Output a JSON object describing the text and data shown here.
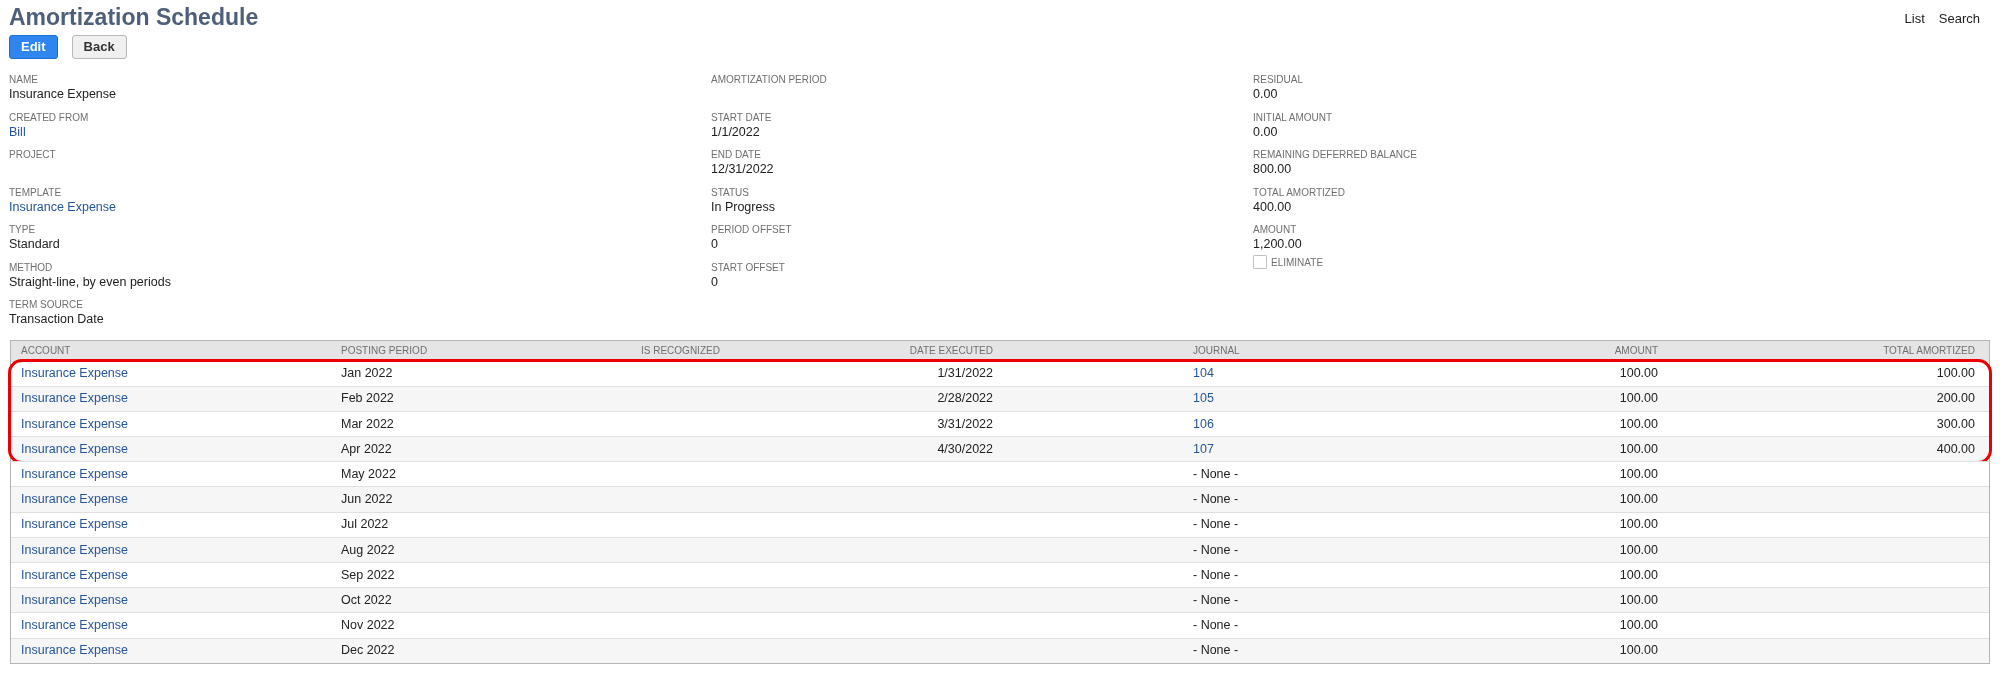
{
  "title": "Amortization Schedule",
  "header_links": [
    "List",
    "Search"
  ],
  "buttons": [
    {
      "label": "Edit",
      "kind": "primary"
    },
    {
      "label": "Back",
      "kind": "secondary"
    }
  ],
  "field_columns": [
    [
      {
        "label": "NAME",
        "value": "Insurance Expense",
        "kind": "text"
      },
      {
        "label": "CREATED FROM",
        "value": "Bill",
        "kind": "link"
      },
      {
        "label": "PROJECT"
      },
      {
        "label": "TEMPLATE",
        "value": "Insurance Expense",
        "kind": "link"
      },
      {
        "label": "TYPE",
        "value": "Standard",
        "kind": "text"
      },
      {
        "label": "METHOD",
        "value": "Straight-line, by even periods",
        "kind": "text"
      },
      {
        "label": "TERM SOURCE",
        "value": "Transaction Date",
        "kind": "text"
      }
    ],
    [
      {
        "label": "AMORTIZATION PERIOD"
      },
      {
        "label": "START DATE",
        "value": "1/1/2022",
        "kind": "text"
      },
      {
        "label": "END DATE",
        "value": "12/31/2022",
        "kind": "text"
      },
      {
        "label": "STATUS",
        "value": "In Progress",
        "kind": "text"
      },
      {
        "label": "PERIOD OFFSET",
        "value": "0",
        "kind": "text"
      },
      {
        "label": "START OFFSET",
        "value": "0",
        "kind": "text"
      }
    ],
    [
      {
        "label": "RESIDUAL",
        "value": "0.00",
        "kind": "text"
      },
      {
        "label": "INITIAL AMOUNT",
        "value": "0.00",
        "kind": "text"
      },
      {
        "label": "REMAINING DEFERRED BALANCE",
        "value": "800.00",
        "kind": "text"
      },
      {
        "label": "TOTAL AMORTIZED",
        "value": "400.00",
        "kind": "text"
      },
      {
        "label": "AMOUNT",
        "value": "1,200.00",
        "kind": "text"
      }
    ]
  ],
  "eliminate": {
    "label": "ELIMINATE",
    "checked": false
  },
  "table": {
    "columns": [
      "ACCOUNT",
      "POSTING PERIOD",
      "IS RECOGNIZED",
      "DATE EXECUTED",
      "JOURNAL",
      "AMOUNT",
      "TOTAL AMORTIZED"
    ],
    "row_groups": [
      {
        "outlined": true,
        "rows": [
          {
            "account": "Insurance Expense",
            "period": "Jan 2022",
            "date_executed": "1/31/2022",
            "journal": {
              "text": "104",
              "kind": "link"
            },
            "amount": "100.00",
            "total_amortized": "100.00"
          },
          {
            "account": "Insurance Expense",
            "period": "Feb 2022",
            "date_executed": "2/28/2022",
            "journal": {
              "text": "105",
              "kind": "link"
            },
            "amount": "100.00",
            "total_amortized": "200.00"
          },
          {
            "account": "Insurance Expense",
            "period": "Mar 2022",
            "date_executed": "3/31/2022",
            "journal": {
              "text": "106",
              "kind": "link"
            },
            "amount": "100.00",
            "total_amortized": "300.00"
          },
          {
            "account": "Insurance Expense",
            "period": "Apr 2022",
            "date_executed": "4/30/2022",
            "journal": {
              "text": "107",
              "kind": "link"
            },
            "amount": "100.00",
            "total_amortized": "400.00"
          }
        ]
      },
      {
        "outlined": false,
        "rows": [
          {
            "account": "Insurance Expense",
            "period": "May 2022",
            "journal": {
              "text": "- None -",
              "kind": "text"
            },
            "amount": "100.00"
          },
          {
            "account": "Insurance Expense",
            "period": "Jun 2022",
            "journal": {
              "text": "- None -",
              "kind": "text"
            },
            "amount": "100.00"
          },
          {
            "account": "Insurance Expense",
            "period": "Jul 2022",
            "journal": {
              "text": "- None -",
              "kind": "text"
            },
            "amount": "100.00"
          },
          {
            "account": "Insurance Expense",
            "period": "Aug 2022",
            "journal": {
              "text": "- None -",
              "kind": "text"
            },
            "amount": "100.00"
          },
          {
            "account": "Insurance Expense",
            "period": "Sep 2022",
            "journal": {
              "text": "- None -",
              "kind": "text"
            },
            "amount": "100.00"
          },
          {
            "account": "Insurance Expense",
            "period": "Oct 2022",
            "journal": {
              "text": "- None -",
              "kind": "text"
            },
            "amount": "100.00"
          },
          {
            "account": "Insurance Expense",
            "period": "Nov 2022",
            "journal": {
              "text": "- None -",
              "kind": "text"
            },
            "amount": "100.00"
          },
          {
            "account": "Insurance Expense",
            "period": "Dec 2022",
            "journal": {
              "text": "- None -",
              "kind": "text"
            },
            "amount": "100.00"
          }
        ]
      }
    ]
  }
}
